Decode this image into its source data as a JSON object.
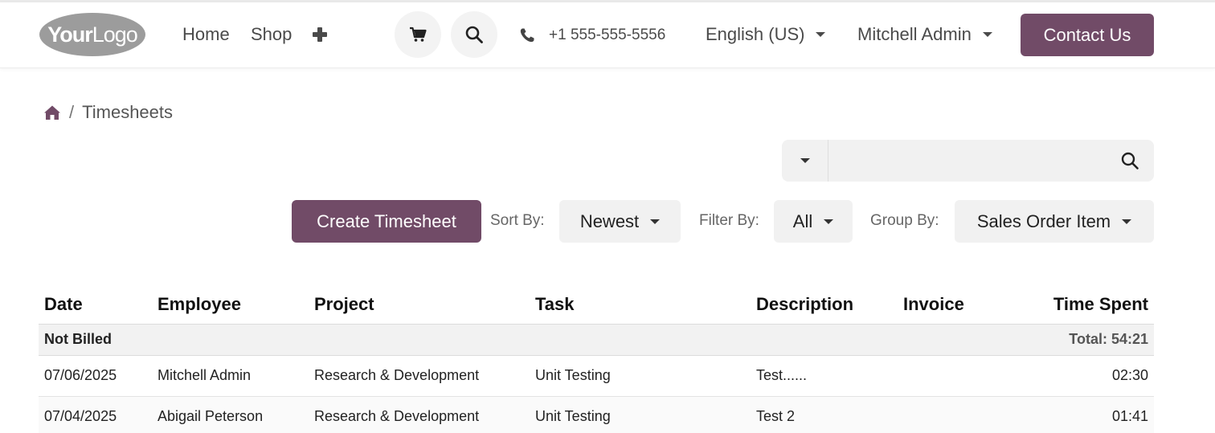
{
  "header": {
    "logo": {
      "text_bold": "Your",
      "text_light": "Logo"
    },
    "nav": [
      {
        "label": "Home"
      },
      {
        "label": "Shop"
      }
    ],
    "phone": "+1 555-555-5556",
    "language": "English (US)",
    "user": "Mitchell Admin",
    "contact_label": "Contact Us"
  },
  "breadcrumb": {
    "current": "Timesheets",
    "separator": "/"
  },
  "search": {
    "placeholder": "",
    "value": ""
  },
  "toolbar": {
    "create_label": "Create Timesheet",
    "sort_label": "Sort By:",
    "sort_value": "Newest",
    "filter_label": "Filter By:",
    "filter_value": "All",
    "group_label": "Group By:",
    "group_value": "Sales Order Item"
  },
  "table": {
    "columns": [
      "Date",
      "Employee",
      "Project",
      "Task",
      "Description",
      "Invoice",
      "Time Spent"
    ],
    "groups": [
      {
        "name": "Not Billed",
        "total": "Total: 54:21",
        "rows": [
          {
            "date": "07/06/2025",
            "employee": "Mitchell Admin",
            "project": "Research & Development",
            "task": "Unit Testing",
            "description": "Test......",
            "invoice": "",
            "time": "02:30"
          },
          {
            "date": "07/04/2025",
            "employee": "Abigail Peterson",
            "project": "Research & Development",
            "task": "Unit Testing",
            "description": "Test 2",
            "invoice": "",
            "time": "01:41"
          }
        ]
      }
    ]
  },
  "colors": {
    "brand": "#714b67",
    "pill_bg": "#f1f1f1",
    "group_bg": "#f2f2f2"
  },
  "icons": [
    "plus-icon",
    "cart-icon",
    "search-icon",
    "phone-icon",
    "home-icon",
    "caret-down-icon"
  ]
}
